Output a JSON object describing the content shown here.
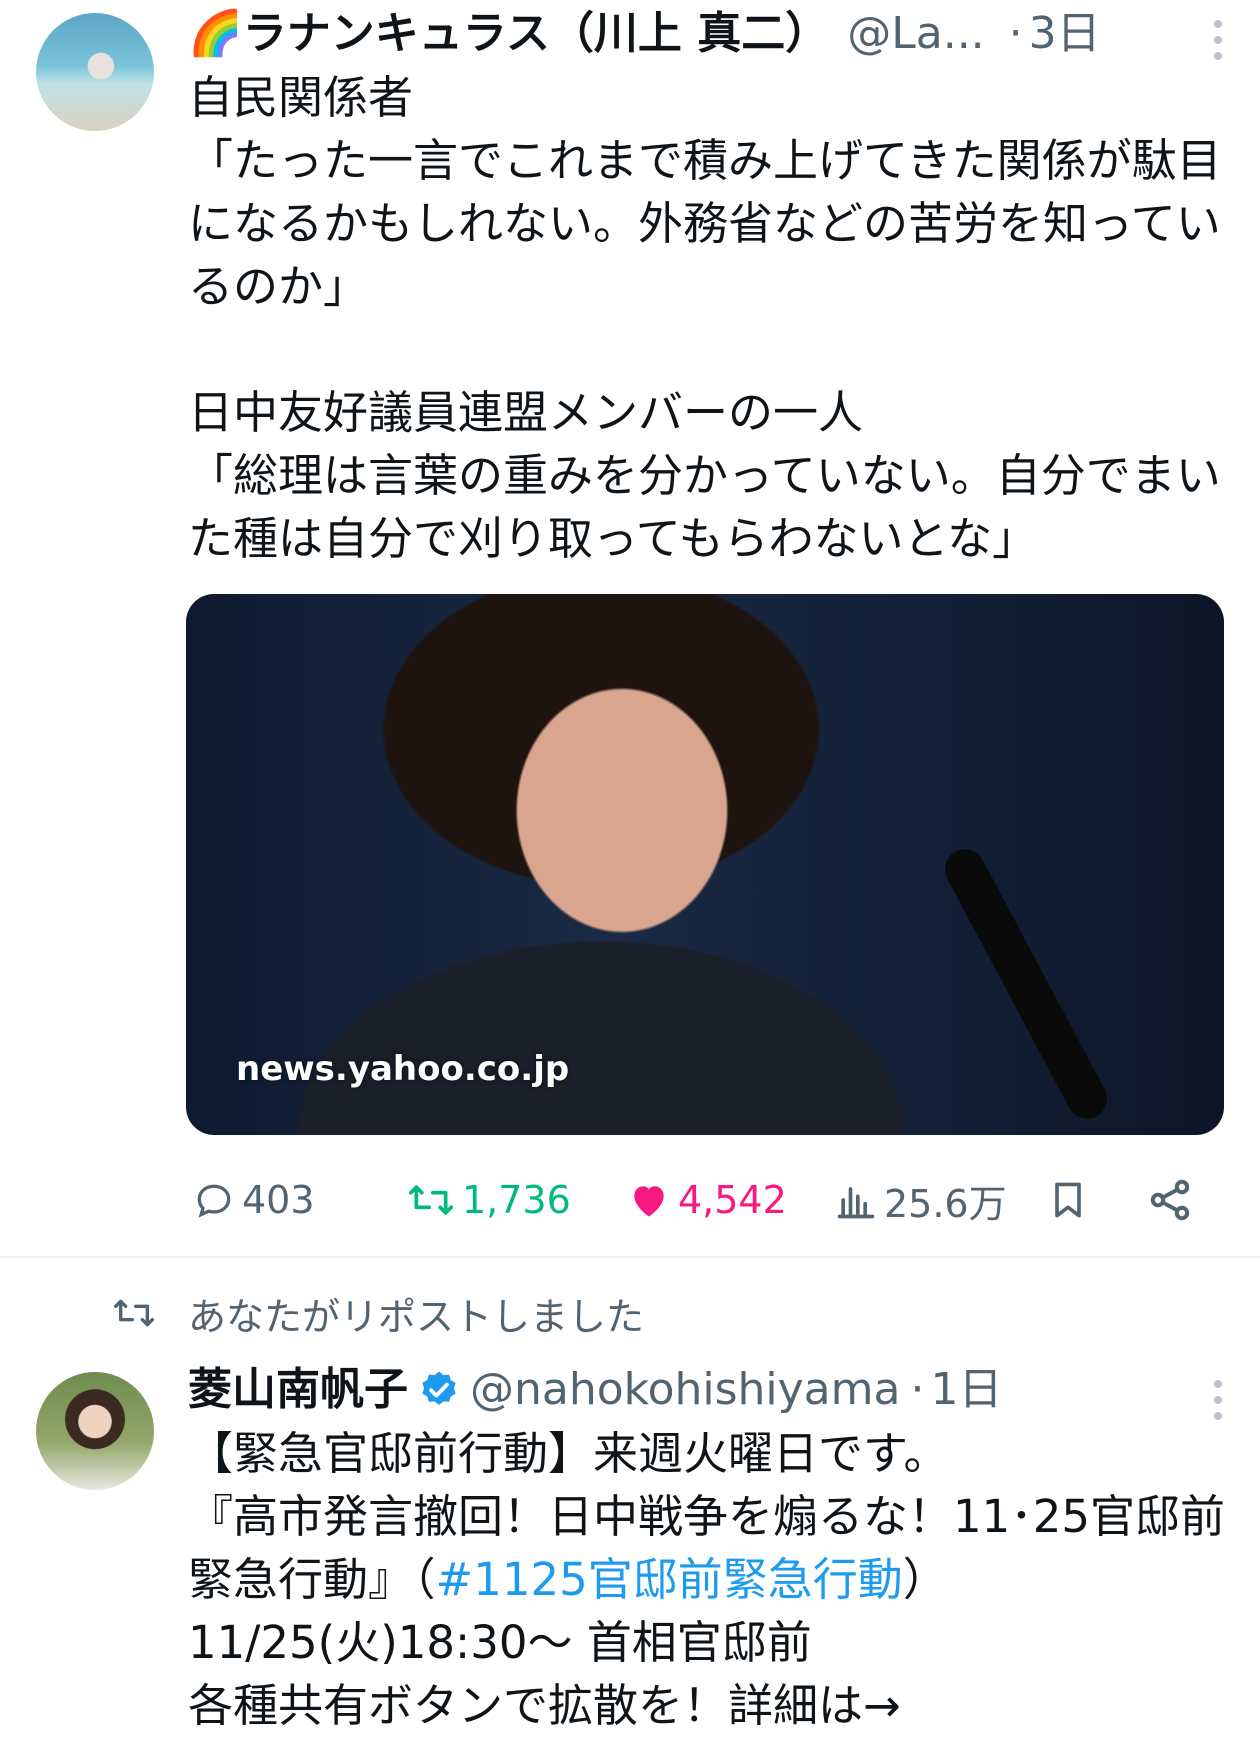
{
  "tweet1": {
    "avatar_label": "avatar",
    "emoji": "🌈",
    "name": "ラナンキュラス（川上 真二）",
    "handle": "@La...",
    "separator": "·",
    "time": "3日",
    "text": "自民関係者\n「たった一言でこれまで積み上げてきた関係が駄目になるかもしれない。外務省などの苦労を知っているのか」\n\n日中友好議員連盟メンバーの一人\n「総理は言葉の重みを分かっていない。自分でまいた種は自分で刈り取ってもらわないとな」",
    "media_caption": "news.yahoo.co.jp",
    "stats": {
      "replies": "403",
      "reposts": "1,736",
      "likes": "4,542",
      "views": "25.6万"
    },
    "colors": {
      "repost": "#00ba7c",
      "like": "#f91880",
      "meta": "#536471"
    },
    "icons": [
      "reply-icon",
      "repost-icon",
      "heart-icon",
      "views-icon",
      "bookmark-icon",
      "share-icon"
    ]
  },
  "repost_banner": {
    "text": "あなたがリポストしました"
  },
  "tweet2": {
    "name": "菱山南帆子",
    "handle": "@nahokohishiyama",
    "separator": "·",
    "time": "1日",
    "line1": "【緊急官邸前行動】来週火曜日です。",
    "line2a": "『高市発言撤回！日中戦争を煽るな！11･25官邸前緊急行動』（",
    "hashtag": "#1125官邸前緊急行動",
    "line2b": "）",
    "line3": "11/25(火)18:30〜 首相官邸前",
    "line4": "各種共有ボタンで拡散を！詳細は→",
    "colors": {
      "link": "#1d9bf0",
      "verified": "#1d9bf0"
    }
  }
}
